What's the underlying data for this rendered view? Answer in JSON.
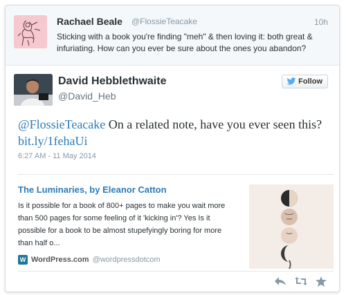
{
  "parent_tweet": {
    "name": "Rachael Beale",
    "handle": "@FlossieTeacake",
    "time": "10h",
    "text": "Sticking with a book you're finding \"meh\" & then loving it: both great & infuriating. How can you ever be sure about the ones you abandon?"
  },
  "main_tweet": {
    "name": "David Hebblethwaite",
    "handle": "@David_Heb",
    "follow_label": "Follow",
    "mention": "@FlossieTeacake",
    "text": " On a related note, have you ever seen this? ",
    "link": "bit.ly/1fehaUi",
    "date": "6:27 AM - 11 May 2014"
  },
  "card": {
    "title": "The Luminaries, by Eleanor Catton",
    "description": "Is it possible for a book of 800+ pages to make you wait more than 500 pages for some feeling of it 'kicking in'? Yes Is it possible for a book to be almost stupefyingly boring for more than half o...",
    "site_icon_letter": "W",
    "site_name": "WordPress.com",
    "site_handle": "@wordpressdotcom"
  },
  "actions": {
    "icons": [
      "reply-icon",
      "retweet-icon",
      "favorite-icon"
    ]
  },
  "colors": {
    "link": "#2b7bb9",
    "muted": "#8899a6",
    "wordpress": "#21759b",
    "twitter_bird": "#55acee"
  }
}
